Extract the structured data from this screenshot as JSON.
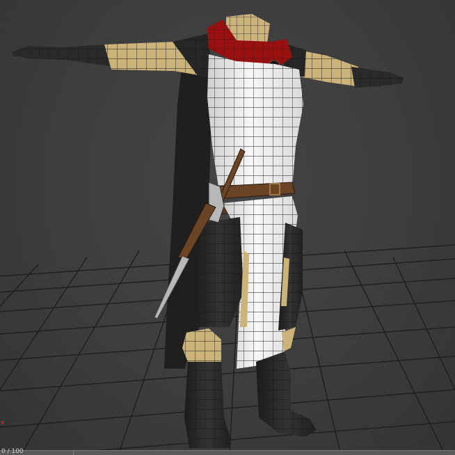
{
  "viewport": {
    "axis_label": "x",
    "frame_readout": "0 / 100"
  },
  "colors": {
    "background": "#3d3d3d",
    "grid": "#1e1e1e",
    "wire": "#1a1a1a",
    "skin": "#cbb37a",
    "tabard": "#f2f2f2",
    "armor": "#2a2a2a",
    "hood": "#9a1010",
    "belt": "#6b4426",
    "blade": "#b8b8b8"
  },
  "model": {
    "name_icon": "knight-character-mesh-icon",
    "grid_icon": "ground-grid-icon"
  }
}
